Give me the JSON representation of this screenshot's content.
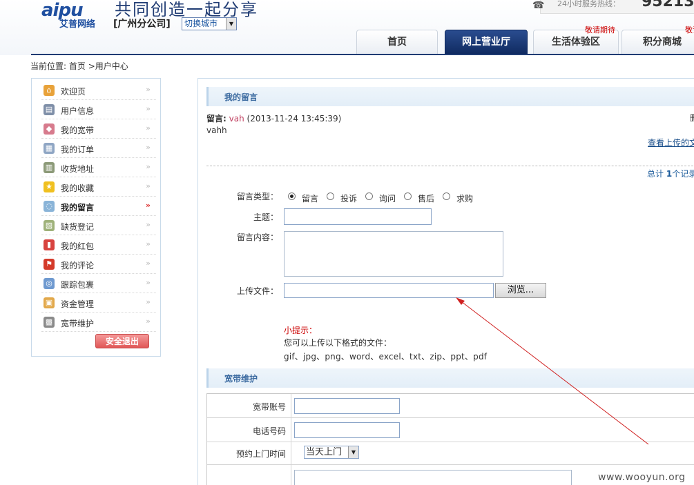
{
  "header": {
    "logo_text": "aipu",
    "logo_sub": "艾普网络",
    "slogan": "共同创造一起分享",
    "branch": "[广州分公司]",
    "city_select": "切换城市",
    "hotline_label": "24小时服务热线：",
    "hotline_number": "95213"
  },
  "nav": {
    "tabs": [
      {
        "label": "首页",
        "badge": ""
      },
      {
        "label": "网上营业厅",
        "badge": ""
      },
      {
        "label": "生活体验区",
        "badge": "敬请期待"
      },
      {
        "label": "积分商城",
        "badge": "敬请期"
      }
    ],
    "active_index": 1
  },
  "breadcrumb": {
    "prefix": "当前位置:",
    "home": "首页",
    "sep": ">",
    "current": "用户中心"
  },
  "sidebar": {
    "items": [
      {
        "label": "欢迎页",
        "icon": "home-icon",
        "color": "#e8a23a"
      },
      {
        "label": "用户信息",
        "icon": "id-card-icon",
        "color": "#7f8fa8"
      },
      {
        "label": "我的宽带",
        "icon": "tag-icon",
        "color": "#d77b8d"
      },
      {
        "label": "我的订单",
        "icon": "document-icon",
        "color": "#8fa6c4"
      },
      {
        "label": "收货地址",
        "icon": "address-book-icon",
        "color": "#8c9a78"
      },
      {
        "label": "我的收藏",
        "icon": "star-icon",
        "color": "#f0c020"
      },
      {
        "label": "我的留言",
        "icon": "chat-bubble-icon",
        "color": "#8ab4d8"
      },
      {
        "label": "缺货登记",
        "icon": "clipboard-icon",
        "color": "#9fb27a"
      },
      {
        "label": "我的红包",
        "icon": "red-packet-icon",
        "color": "#d8433f"
      },
      {
        "label": "我的评论",
        "icon": "flag-icon",
        "color": "#d43a2a"
      },
      {
        "label": "跟踪包裹",
        "icon": "search-package-icon",
        "color": "#6f9ad0"
      },
      {
        "label": "资金管理",
        "icon": "wallet-icon",
        "color": "#e2a84a"
      },
      {
        "label": "宽带维护",
        "icon": "toolbox-icon",
        "color": "#8a8a8a"
      }
    ],
    "active_index": 6,
    "logout_label": "安全退出"
  },
  "messages": {
    "section_title": "我的留言",
    "item": {
      "prefix": "留言:",
      "user": "vah",
      "time": "(2013-11-24 13:45:39)",
      "body": "vahh",
      "delete_label": "删",
      "view_upload": "查看上传的文"
    },
    "total_prefix": "总计",
    "total_count": "1",
    "total_suffix": "个记录"
  },
  "form": {
    "type_label": "留言类型：",
    "types": [
      "留言",
      "投诉",
      "询问",
      "售后",
      "求购"
    ],
    "type_selected": 0,
    "subject_label": "主题：",
    "content_label": "留言内容：",
    "upload_label": "上传文件：",
    "browse_label": "浏览...",
    "tip_title": "小提示：",
    "tip_text": "您可以上传以下格式的文件：",
    "tip_formats": "gif、jpg、png、word、excel、txt、zip、ppt、pdf"
  },
  "broadband": {
    "section_title": "宽带维护",
    "account_label": "宽带账号",
    "phone_label": "电话号码",
    "visit_label": "预约上门时间",
    "visit_select": "当天上门"
  },
  "watermark": "www.wooyun.org"
}
